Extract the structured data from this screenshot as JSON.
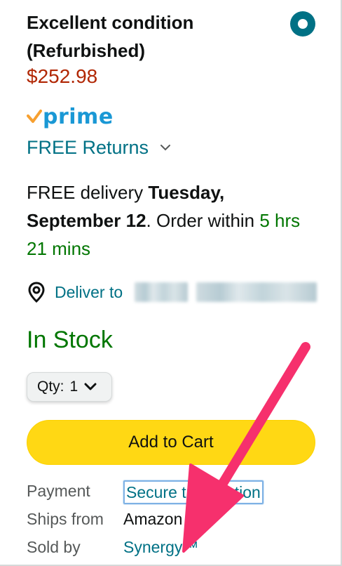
{
  "offer": {
    "condition_title": "Excellent condition (Refurbished)",
    "price": "$252.98",
    "prime_label": "prime",
    "returns_label": "FREE Returns"
  },
  "delivery": {
    "prefix": "FREE delivery ",
    "date": "Tuesday, September 12",
    "middle": ". Order within ",
    "countdown": "5 hrs 21 mins"
  },
  "deliver_to": {
    "label": "Deliver to"
  },
  "stock": {
    "status": "In Stock"
  },
  "quantity": {
    "label": "Qty:",
    "value": "1"
  },
  "actions": {
    "add_to_cart": "Add to Cart"
  },
  "details": {
    "payment_label": "Payment",
    "payment_value": "Secure transaction",
    "ships_from_label": "Ships from",
    "ships_from_value": "Amazon",
    "sold_by_label": "Sold by",
    "sold_by_value": "Synergy™"
  },
  "colors": {
    "accent_teal": "#007185",
    "price_red": "#b12704",
    "stock_green": "#007600",
    "cart_yellow": "#ffd814",
    "prime_blue": "#1a98d5",
    "annotation_pink": "#f6306d"
  },
  "icons": {
    "radio": "radio-selected-icon",
    "prime_check": "prime-check-icon",
    "returns_chevron": "chevron-down-icon",
    "location": "location-pin-icon",
    "qty_chevron": "chevron-down-icon",
    "annotation": "pink-arrow-icon"
  }
}
